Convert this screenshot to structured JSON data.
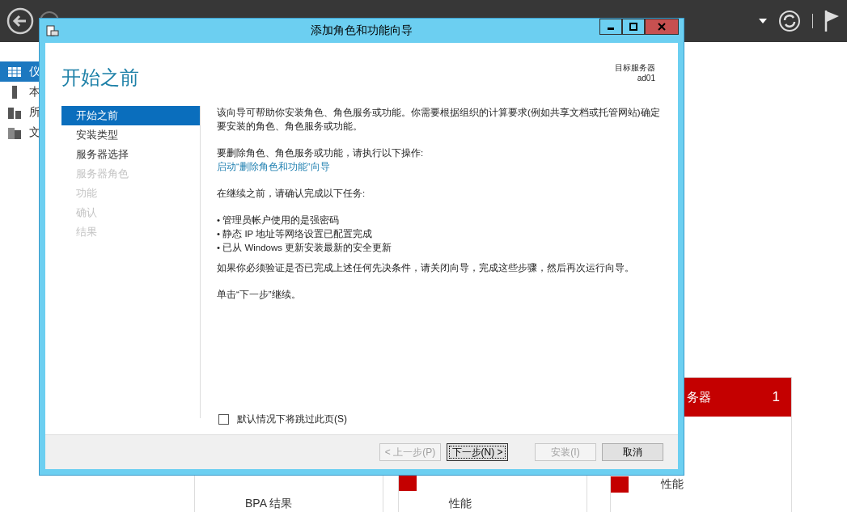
{
  "background": {
    "nav_items": [
      {
        "label": "仪",
        "selected": true
      },
      {
        "label": "本",
        "selected": false
      },
      {
        "label": "所",
        "selected": false
      },
      {
        "label": "文",
        "selected": false
      }
    ],
    "tiles": [
      {
        "items": [
          {
            "label": "BPA 结果",
            "alert": false
          }
        ]
      },
      {
        "items": [
          {
            "alert": true
          },
          {
            "label": "性能",
            "alert": false
          }
        ]
      },
      {
        "header": "务器",
        "count": "1",
        "items": [
          {
            "label": "性能",
            "alert": true
          }
        ]
      }
    ]
  },
  "dialog": {
    "title": "添加角色和功能向导",
    "heading": "开始之前",
    "target_label": "目标服务器",
    "target_value": "ad01",
    "steps": [
      {
        "label": "开始之前",
        "selected": true,
        "disabled": false
      },
      {
        "label": "安装类型",
        "selected": false,
        "disabled": false
      },
      {
        "label": "服务器选择",
        "selected": false,
        "disabled": false
      },
      {
        "label": "服务器角色",
        "selected": false,
        "disabled": true
      },
      {
        "label": "功能",
        "selected": false,
        "disabled": true
      },
      {
        "label": "确认",
        "selected": false,
        "disabled": true
      },
      {
        "label": "结果",
        "selected": false,
        "disabled": true
      }
    ],
    "content": [
      {
        "kind": "text",
        "text": "该向导可帮助你安装角色、角色服务或功能。你需要根据组织的计算要求(例如共享文档或托管网站)确定要安装的角色、角色服务或功能。"
      },
      {
        "kind": "text_link",
        "text": "要删除角色、角色服务或功能，请执行以下操作:",
        "link": "启动“删除角色和功能”向导"
      },
      {
        "kind": "text",
        "text": "在继续之前，请确认完成以下任务:"
      },
      {
        "kind": "bullets",
        "items": [
          "• 管理员帐户使用的是强密码",
          "• 静态 IP 地址等网络设置已配置完成",
          "• 已从 Windows 更新安装最新的安全更新"
        ]
      },
      {
        "kind": "text",
        "text": "如果你必须验证是否已完成上述任何先决条件，请关闭向导，完成这些步骤，然后再次运行向导。"
      },
      {
        "kind": "text",
        "text": "单击“下一步”继续。"
      }
    ],
    "skip_checkbox": {
      "label": "默认情况下将跳过此页(S)",
      "checked": false
    },
    "buttons": [
      {
        "label": "< 上一步(P)",
        "disabled": true,
        "focused": false
      },
      {
        "label": "下一步(N) >",
        "disabled": false,
        "focused": true
      },
      {
        "label": "安装(I)",
        "disabled": true,
        "focused": false
      },
      {
        "label": "取消",
        "disabled": false,
        "focused": false
      }
    ]
  }
}
